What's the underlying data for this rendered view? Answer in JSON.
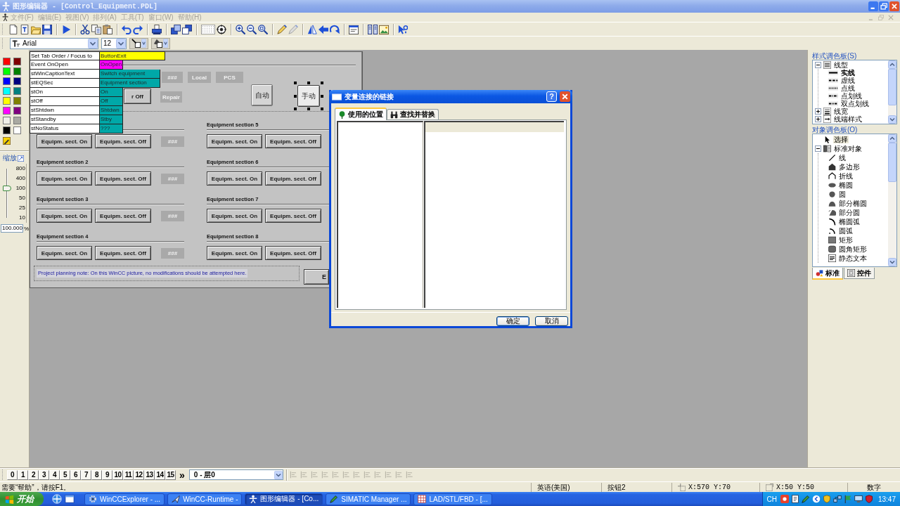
{
  "window": {
    "title": "图形编辑器 - [Control_Equipment.PDL]"
  },
  "menu": [
    {
      "label": "文件(F)",
      "disabled": true
    },
    {
      "label": "编辑(E)",
      "disabled": true
    },
    {
      "label": "视图(V)",
      "disabled": true
    },
    {
      "label": "排列(A)",
      "disabled": true
    },
    {
      "label": "工具(T)",
      "disabled": true
    },
    {
      "label": "窗口(W)",
      "disabled": true
    },
    {
      "label": "帮助(H)",
      "disabled": true
    }
  ],
  "format_bar": {
    "font": "Arial",
    "size": "12"
  },
  "color_palette": [
    {
      "color": "#ff0000"
    },
    {
      "color": "#800000"
    },
    {
      "color": "#00ff00"
    },
    {
      "color": "#008000"
    },
    {
      "color": "#0000ff"
    },
    {
      "color": "#000080"
    },
    {
      "color": "#00ffff"
    },
    {
      "color": "#008080"
    },
    {
      "color": "#ffff00"
    },
    {
      "color": "#808000"
    },
    {
      "color": "#ff00ff"
    },
    {
      "color": "#800080"
    },
    {
      "color": "#f0efe9"
    },
    {
      "color": "#a9a9a2"
    },
    {
      "color": "#000000"
    },
    {
      "color": "#ffffff"
    }
  ],
  "zoom": {
    "label": "缩放",
    "ticks": [
      "800",
      "400",
      "100",
      "50",
      "25",
      "10"
    ],
    "level": 0.6,
    "value": "100.000",
    "unit": "%"
  },
  "picture": {
    "tag_overlay": [
      {
        "name": "Set Tab Order / Focus to",
        "value": "ButtonExit",
        "color": "#ffff00"
      },
      {
        "name": "Event OnOpen",
        "value": "OnOpen",
        "color": "#ff00ff"
      },
      {
        "name": "stWinCaptionText",
        "value": "Switch equipment",
        "color": "#00a8a8"
      },
      {
        "name": "stEQSec",
        "value": "Equipment section",
        "color": "#00a8a8"
      },
      {
        "name": "stOn",
        "value": "On",
        "color": "#00a8a8"
      },
      {
        "name": "stOff",
        "value": "Off",
        "color": "#00a8a8"
      },
      {
        "name": "stShtdwn",
        "value": "Shtdwn",
        "color": "#00a8a8"
      },
      {
        "name": "stStandby",
        "value": "Stby",
        "color": "#00a8a8"
      },
      {
        "name": "stNoStatus",
        "value": "???",
        "color": "#00a8a8"
      }
    ],
    "status_fields": [
      "###",
      "Local",
      "PCS",
      "Repair"
    ],
    "off_button": "r Off",
    "mode_buttons": [
      {
        "label": "自动",
        "selected": false
      },
      {
        "label": "手动",
        "selected": true
      }
    ],
    "sections": [
      {
        "on": "Equipm. sect. On",
        "off": "Equipm. sect. Off",
        "value": "###"
      },
      {
        "title": "Equipment section 2",
        "on": "Equipm. sect. On",
        "off": "Equipm. sect. Off",
        "value": "###"
      },
      {
        "title": "Equipment section 3",
        "on": "Equipm. sect. On",
        "off": "Equipm. sect. Off",
        "value": "###"
      },
      {
        "title": "Equipment section 4",
        "on": "Equipm. sect. On",
        "off": "Equipm. sect. Off",
        "value": "###"
      },
      {
        "title": "Equipment section 5",
        "on": "Equipm. sect. On",
        "off": "Equipm. sect. Off"
      },
      {
        "title": "Equipment section 6",
        "on": "Equipm. sect. On",
        "off": "Equipm. sect. Off"
      },
      {
        "title": "Equipment section 7",
        "on": "Equipm. sect. On",
        "off": "Equipm. sect. Off"
      },
      {
        "title": "Equipment section 8",
        "on": "Equipm. sect. On",
        "off": "Equipm. sect. Off"
      }
    ],
    "note": "Project planning note: On this WinCC picture, no modifications should be attempted here.",
    "exit_button": "E"
  },
  "style_palette": {
    "title": "样式调色板(S)",
    "tree": [
      {
        "label": "线型",
        "expanded": true,
        "children": [
          {
            "label": "实线",
            "kind": "solid",
            "selected": true
          },
          {
            "label": "虚线",
            "kind": "dash",
            "selected": false
          },
          {
            "label": "点线",
            "kind": "dot",
            "selected": false
          },
          {
            "label": "点划线",
            "kind": "dash-dot",
            "selected": false
          },
          {
            "label": "双点划线",
            "kind": "dash-dot-dot",
            "selected": false
          }
        ]
      },
      {
        "label": "线宽",
        "expanded": false
      },
      {
        "label": "线端样式",
        "expanded": false
      }
    ]
  },
  "object_palette": {
    "title": "对象调色板(O)",
    "tree": [
      {
        "label": "选择",
        "kind": "pointer",
        "selected": true
      },
      {
        "label": "标准对象",
        "kind": "objects",
        "expanded": true,
        "selected": false,
        "children": [
          {
            "label": "线",
            "kind": "line",
            "selected": false
          },
          {
            "label": "多边形",
            "kind": "polygon",
            "selected": false
          },
          {
            "label": "折线",
            "kind": "polyline",
            "selected": false
          },
          {
            "label": "椭圆",
            "kind": "ellipse",
            "selected": false
          },
          {
            "label": "圆",
            "kind": "circle",
            "selected": false
          },
          {
            "label": "部分椭圆",
            "kind": "ellipse-segment",
            "selected": false
          },
          {
            "label": "部分圆",
            "kind": "circle-segment",
            "selected": false
          },
          {
            "label": "椭圆弧",
            "kind": "ellipse-arc",
            "selected": false
          },
          {
            "label": "圆弧",
            "kind": "circle-arc",
            "selected": false
          },
          {
            "label": "矩形",
            "kind": "rectangle",
            "selected": false
          },
          {
            "label": "圆角矩形",
            "kind": "rounded-rectangle",
            "selected": false
          },
          {
            "label": "静态文本",
            "kind": "static-text",
            "selected": false
          }
        ]
      }
    ],
    "tabs": [
      {
        "label": "标准",
        "selected": true
      },
      {
        "label": "控件",
        "selected": false
      }
    ]
  },
  "dialog": {
    "title": "变量连接的链接",
    "help": "?",
    "tabs": [
      {
        "label": "使用的位置",
        "selected": true
      },
      {
        "label": "查找并替换",
        "selected": false
      }
    ],
    "buttons": [
      {
        "label": "确定",
        "default": true
      },
      {
        "label": "取消",
        "default": false
      }
    ]
  },
  "layer_bar": {
    "layers": [
      "0",
      "1",
      "2",
      "3",
      "4",
      "5",
      "6",
      "7",
      "8",
      "9",
      "10",
      "11",
      "12",
      "13",
      "14",
      "15"
    ],
    "more": "»",
    "layer": "0 - 层0"
  },
  "status_bar": {
    "hint": "需要“帮助”，请按F1。",
    "language": "英语(美国)",
    "object": "按钮2",
    "position": "X:570 Y:70",
    "size": "X:50 Y:50",
    "mode": "数字"
  },
  "taskbar": {
    "start": "开始",
    "tasks": [
      {
        "label": "WinCCExplorer - ...",
        "selected": false
      },
      {
        "label": "WinCC-Runtime -",
        "selected": false
      },
      {
        "label": "图形编辑器 - [Co...",
        "selected": true
      },
      {
        "label": "SIMATIC Manager ...",
        "selected": false
      },
      {
        "label": "LAD/STL/FBD - [...",
        "selected": false
      }
    ],
    "tray": {
      "language": "CH",
      "clock": "13:47"
    }
  }
}
